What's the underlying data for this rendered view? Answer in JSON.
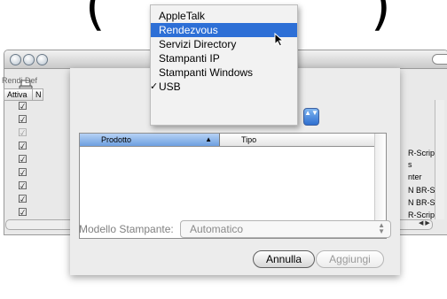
{
  "menu": {
    "items": [
      {
        "label": "AppleTalk",
        "highlighted": false,
        "checked": false
      },
      {
        "label": "Rendezvous",
        "highlighted": true,
        "checked": false
      },
      {
        "label": "Servizi Directory",
        "highlighted": false,
        "checked": false
      },
      {
        "label": "Stampanti IP",
        "highlighted": false,
        "checked": false
      },
      {
        "label": "Stampanti Windows",
        "highlighted": false,
        "checked": false
      },
      {
        "label": "USB",
        "highlighted": false,
        "checked": true
      }
    ],
    "check_mark": "✓"
  },
  "window": {
    "toolbar_label": "Rendi Def",
    "col_attiva": "Attiva",
    "col_n": "N",
    "rows_right_text": [
      "R-Script",
      "s",
      "nter",
      "N BR-Scri",
      "N BR-Scri",
      "R-Script",
      "nter"
    ],
    "row0_prefix": "BR-Script",
    "check_mark": "☑"
  },
  "sheet": {
    "list_headers": {
      "product": "Prodotto",
      "type": "Tipo",
      "sort_arrow": "▲"
    },
    "model_label": "Modello Stampante:",
    "model_value": "Automatico",
    "cancel_label": "Annulla",
    "add_label": "Aggiungi",
    "popup_arrows": "▲▼"
  },
  "colors": {
    "highlight": "#2d6fd6",
    "sorted_header": "#6d9fe0"
  },
  "icons": [
    "printer-icon",
    "arrow-cursor-icon",
    "popup-arrows-icon"
  ]
}
